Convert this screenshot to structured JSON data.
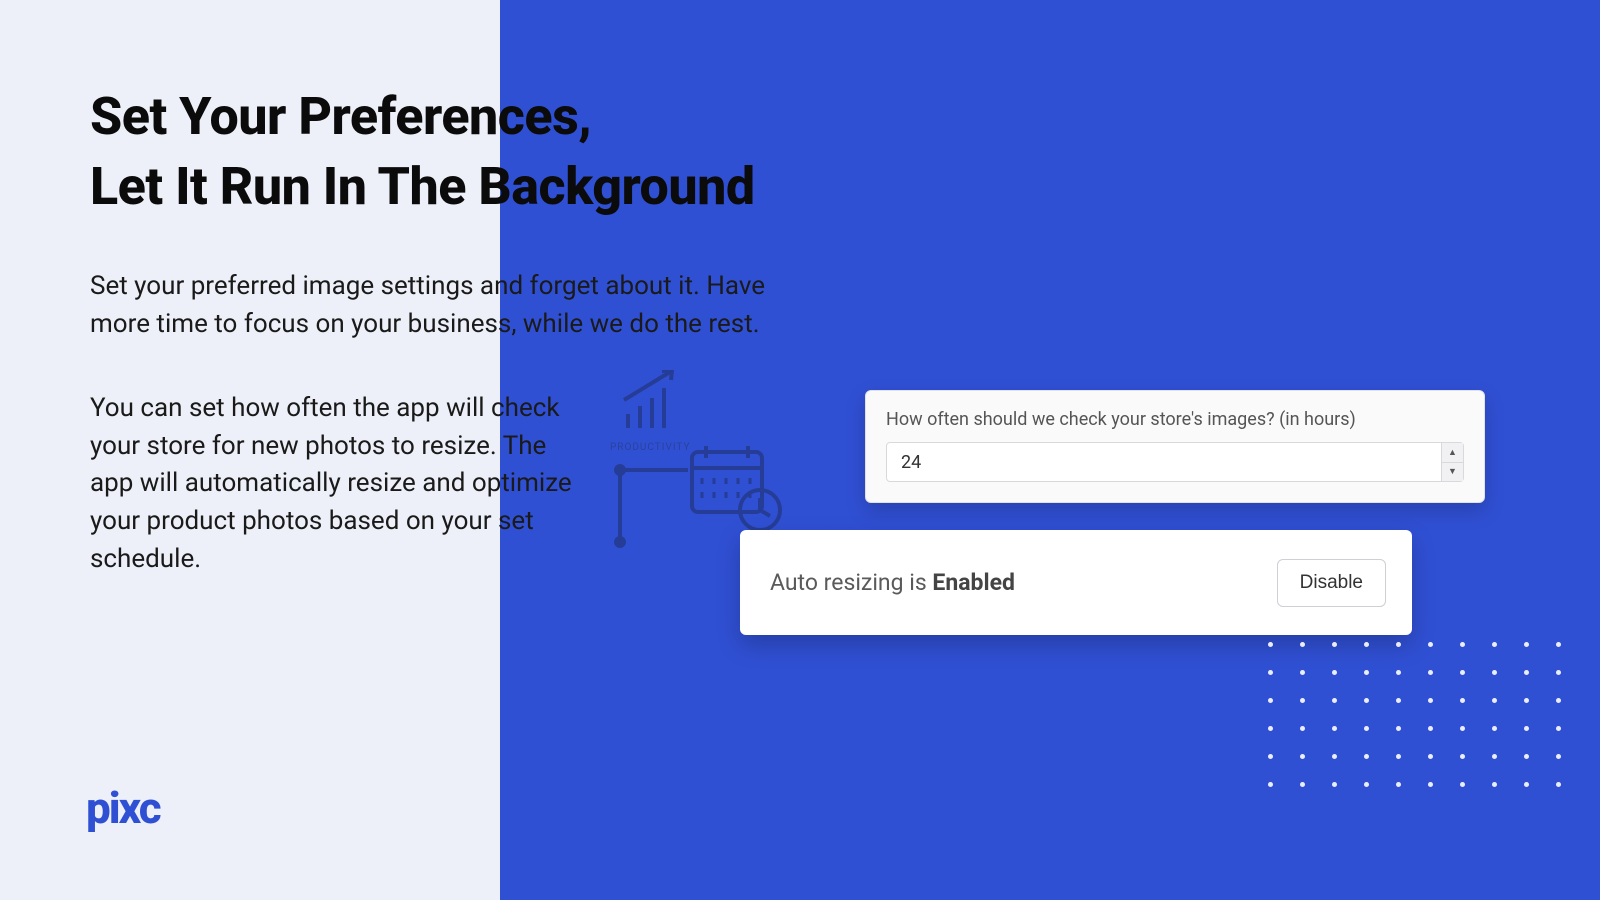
{
  "heading_line1": "Set Your Preferences,",
  "heading_line2": "Let It Run In The Background",
  "paragraph1": "Set your preferred image settings and forget about it. Have more time to focus on your business, while we do the rest.",
  "paragraph2": "You can set how often the app will check your store for new photos to resize. The app will automatically resize and optimize your product photos based on your set schedule.",
  "logo_text": "pixc",
  "settings": {
    "interval_label": "How often should we check your store's images? (in hours)",
    "interval_value": "24"
  },
  "autoresize": {
    "prefix": "Auto resizing is ",
    "state": "Enabled",
    "button": "Disable"
  },
  "decor_label": "PRODUCTIVITY"
}
